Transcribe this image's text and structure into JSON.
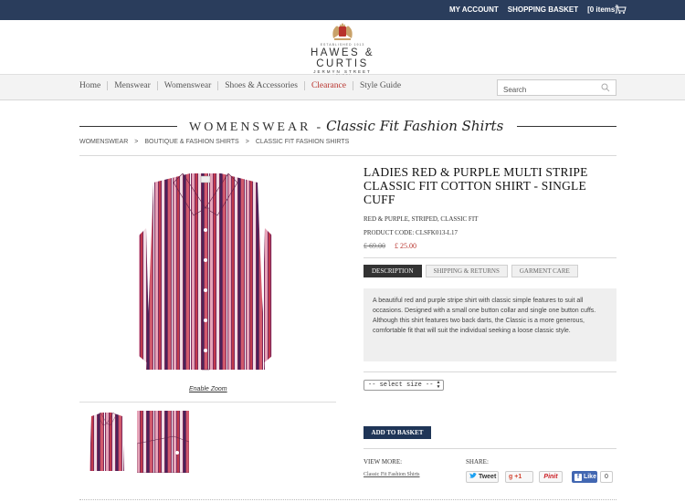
{
  "topbar": {
    "my_account": "MY ACCOUNT",
    "shopping_basket": "SHOPPING BASKET",
    "basket_items": "[0 items]"
  },
  "logo": {
    "established": "ESTABLISHED 1913",
    "brand": "HAWES & CURTIS",
    "street": "JERMYN STREET",
    "city": "LONDON"
  },
  "nav": {
    "items": [
      "Home",
      "Menswear",
      "Womenswear",
      "Shoes & Accessories",
      "Clearance",
      "Style Guide"
    ],
    "active_color": "#b8322c"
  },
  "search": {
    "placeholder": "Search"
  },
  "section": {
    "category": "WOMENSWEAR",
    "dash": "-",
    "subtitle": "Classic Fit Fashion Shirts"
  },
  "breadcrumb": [
    "WOMENSWEAR",
    ">",
    "BOUTIQUE & FASHION SHIRTS",
    ">",
    "CLASSIC FIT FASHION SHIRTS"
  ],
  "gallery": {
    "enable_zoom": "Enable Zoom"
  },
  "product": {
    "title": "LADIES RED & PURPLE MULTI STRIPE CLASSIC FIT COTTON SHIRT - SINGLE CUFF",
    "attributes": "RED & PURPLE, STRIPED, CLASSIC FIT",
    "code": "PRODUCT CODE: CLSFK013-L17",
    "price_old": "£ 69.00",
    "price_new": "£ 25.00",
    "price_color": "#b8322c"
  },
  "tabs": [
    "DESCRIPTION",
    "SHIPPING & RETURNS",
    "GARMENT CARE"
  ],
  "description": "A beautiful red and purple stripe shirt with classic simple features to suit all occasions. Designed with a small one button collar and single one button cuffs. Although this shirt features two back darts, the Classic is a more generous, comfortable fit that will suit the individual seeking a loose classic style.",
  "size_select": {
    "selected": "-- select size --"
  },
  "add_to_basket": "ADD TO BASKET",
  "view_more": {
    "label": "VIEW MORE:",
    "link": "Classic Fit Fashion Shirts"
  },
  "share": {
    "label": "SHARE:",
    "tweet": "Tweet",
    "gplus": "+1",
    "pinit": "Pinit",
    "like": "Like",
    "like_count": "0"
  },
  "colors": {
    "topbar": "#2a3d5c",
    "button": "#1f3557",
    "accent": "#b8322c"
  }
}
